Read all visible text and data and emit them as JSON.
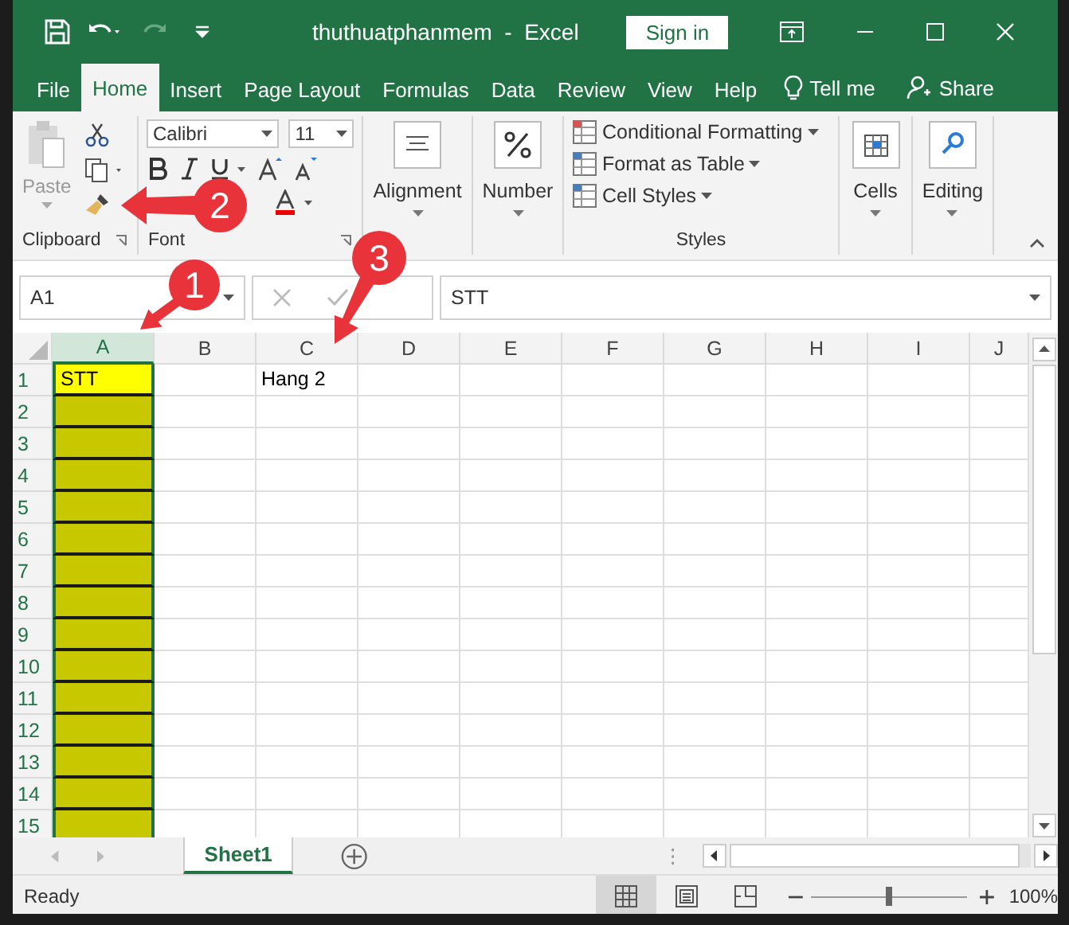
{
  "window": {
    "title": "thuthuatphanmem  -  Excel",
    "sign_in": "Sign in"
  },
  "menu_tabs": [
    {
      "label": "File",
      "selected": false
    },
    {
      "label": "Home",
      "selected": true
    },
    {
      "label": "Insert",
      "selected": false
    },
    {
      "label": "Page Layout",
      "selected": false
    },
    {
      "label": "Formulas",
      "selected": false
    },
    {
      "label": "Data",
      "selected": false
    },
    {
      "label": "Review",
      "selected": false
    },
    {
      "label": "View",
      "selected": false
    },
    {
      "label": "Help",
      "selected": false
    }
  ],
  "tell_me": "Tell me",
  "share": "Share",
  "ribbon": {
    "paste": "Paste",
    "clipboard": "Clipboard",
    "font_name": "Calibri",
    "font_size": "11",
    "font": "Font",
    "alignment": "Alignment",
    "number": "Number",
    "styles": [
      "Conditional Formatting",
      "Format as Table",
      "Cell Styles"
    ],
    "styles_group": "Styles",
    "cells": "Cells",
    "editing": "Editing"
  },
  "formula_bar": {
    "name_box": "A1",
    "formula": "STT"
  },
  "columns": [
    {
      "label": "A",
      "selected": true
    },
    {
      "label": "B",
      "selected": false
    },
    {
      "label": "C",
      "selected": false
    },
    {
      "label": "D",
      "selected": false
    },
    {
      "label": "E",
      "selected": false
    },
    {
      "label": "F",
      "selected": false
    },
    {
      "label": "G",
      "selected": false
    },
    {
      "label": "H",
      "selected": false
    },
    {
      "label": "I",
      "selected": false
    },
    {
      "label": "J",
      "selected": false
    }
  ],
  "rows": [
    {
      "label": "1",
      "cells": [
        {
          "text": "STT",
          "color": "#ffff00"
        },
        {},
        {
          "text": "Hang 2"
        },
        {},
        {},
        {},
        {},
        {},
        {},
        {}
      ]
    },
    {
      "label": "2",
      "cells": [
        {
          "color": "#c8c800"
        },
        {},
        {},
        {},
        {},
        {},
        {},
        {},
        {},
        {}
      ]
    },
    {
      "label": "3",
      "cells": [
        {
          "color": "#c8c800"
        },
        {},
        {},
        {},
        {},
        {},
        {},
        {},
        {},
        {}
      ]
    },
    {
      "label": "4",
      "cells": [
        {
          "color": "#c8c800"
        },
        {},
        {},
        {},
        {},
        {},
        {},
        {},
        {},
        {}
      ]
    },
    {
      "label": "5",
      "cells": [
        {
          "color": "#c8c800"
        },
        {},
        {},
        {},
        {},
        {},
        {},
        {},
        {},
        {}
      ]
    },
    {
      "label": "6",
      "cells": [
        {
          "color": "#c8c800"
        },
        {},
        {},
        {},
        {},
        {},
        {},
        {},
        {},
        {}
      ]
    },
    {
      "label": "7",
      "cells": [
        {
          "color": "#c8c800"
        },
        {},
        {},
        {},
        {},
        {},
        {},
        {},
        {},
        {}
      ]
    },
    {
      "label": "8",
      "cells": [
        {
          "color": "#c8c800"
        },
        {},
        {},
        {},
        {},
        {},
        {},
        {},
        {},
        {}
      ]
    },
    {
      "label": "9",
      "cells": [
        {
          "color": "#c8c800"
        },
        {},
        {},
        {},
        {},
        {},
        {},
        {},
        {},
        {}
      ]
    },
    {
      "label": "10",
      "cells": [
        {
          "color": "#c8c800"
        },
        {},
        {},
        {},
        {},
        {},
        {},
        {},
        {},
        {}
      ]
    },
    {
      "label": "11",
      "cells": [
        {
          "color": "#c8c800"
        },
        {},
        {},
        {},
        {},
        {},
        {},
        {},
        {},
        {}
      ]
    },
    {
      "label": "12",
      "cells": [
        {
          "color": "#c8c800"
        },
        {},
        {},
        {},
        {},
        {},
        {},
        {},
        {},
        {}
      ]
    },
    {
      "label": "13",
      "cells": [
        {
          "color": "#c8c800"
        },
        {},
        {},
        {},
        {},
        {},
        {},
        {},
        {},
        {}
      ]
    },
    {
      "label": "14",
      "cells": [
        {
          "color": "#c8c800"
        },
        {},
        {},
        {},
        {},
        {},
        {},
        {},
        {},
        {}
      ]
    },
    {
      "label": "15",
      "cells": [
        {
          "color": "#c8c800"
        },
        {},
        {},
        {},
        {},
        {},
        {},
        {},
        {},
        {}
      ]
    }
  ],
  "sheet_tabs": [
    {
      "label": "Sheet1",
      "selected": true
    }
  ],
  "status_bar": {
    "status": "Ready",
    "views": [
      {
        "kind": "normal",
        "selected": true
      },
      {
        "kind": "layout",
        "selected": false
      },
      {
        "kind": "pagebreak",
        "selected": false
      }
    ],
    "zoom": {
      "level": 0.5,
      "reading": "100%"
    }
  },
  "annotations": [
    {
      "label": "1"
    },
    {
      "label": "2"
    },
    {
      "label": "3"
    }
  ]
}
